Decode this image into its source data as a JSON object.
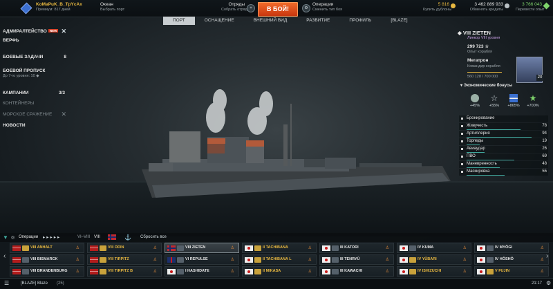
{
  "player": {
    "name": "KoMaPuK_B_TpYcAx",
    "premium": "Премиум: 817 дней"
  },
  "port": {
    "name": "Океан",
    "hint": "Выбрать порт"
  },
  "squad": {
    "title": "Отряды",
    "hint": "Собрать отряд"
  },
  "battle_button": "В БОЙ!",
  "operations": {
    "title": "Операции",
    "hint": "Сменить тип боя"
  },
  "currency": {
    "doubloons": {
      "value": "5 816",
      "hint": "Купить дублоны"
    },
    "credits": {
      "value": "3 462 889 933",
      "hint": "Обменять кредиты"
    },
    "free_xp": {
      "value": "3 766 043",
      "hint": "Перевести опыт"
    }
  },
  "tabs": [
    "ПОРТ",
    "ОСНАЩЕНИЕ",
    "ВНЕШНИЙ ВИД",
    "РАЗВИТИЕ",
    "ПРОФИЛЬ",
    "[BLAZE]"
  ],
  "left_menu": {
    "admiralty": "АДМИРАЛТЕЙСТВО",
    "admiralty_badge": "NEW",
    "shipyard": "ВЕРФЬ",
    "combat_missions": "БОЕВЫЕ ЗАДАЧИ",
    "combat_missions_count": "8",
    "battle_pass": "БОЕВОЙ ПРОПУСК",
    "battle_pass_sub": "До 7-го уровня: 10",
    "campaigns": "КАМПАНИИ",
    "campaigns_count": "3/3",
    "containers": "КОНТЕЙНЕРЫ",
    "naval_battle": "МОРСКОЕ СРАЖЕНИЕ",
    "news": "НОВОСТИ"
  },
  "ship_panel": {
    "name": "VIII ZIETEN",
    "type": "Линкор VIII уровня",
    "xp": "299 723",
    "xp_label": "Опыт корабля",
    "commander": "Мегатрон",
    "commander_role": "Командир корабля",
    "commander_xp": "560 128 / 700 000",
    "commander_level": "20",
    "economy_title": "Экономические бонусы",
    "economy": [
      "+45%",
      "+55%",
      "+865%",
      "+700%"
    ],
    "stats": [
      {
        "label": "Бронирование",
        "value": ""
      },
      {
        "label": "Живучесть",
        "value": "78"
      },
      {
        "label": "Артиллерия",
        "value": "94"
      },
      {
        "label": "Торпеды",
        "value": "19"
      },
      {
        "label": "Авиаудар",
        "value": "26"
      },
      {
        "label": "ПВО",
        "value": "69"
      },
      {
        "label": "Маневренность",
        "value": "48"
      },
      {
        "label": "Маскировка",
        "value": "55"
      }
    ]
  },
  "filter_bar": {
    "mode": "Операции",
    "tiers": "VI–VIII",
    "tier_sel": "VIII",
    "reset": "Сбросить все"
  },
  "ships": [
    {
      "name": "VIII ANHALT",
      "flag": "de",
      "tier": "gold",
      "sel": false
    },
    {
      "name": "VIII ODIN",
      "flag": "de",
      "tier": "gold",
      "sel": false
    },
    {
      "name": "VIII ZIETEN",
      "flag": "no",
      "tier": "grey",
      "sel": true
    },
    {
      "name": "II TACHIBANA",
      "flag": "jp",
      "tier": "gold",
      "sel": false
    },
    {
      "name": "III KATORI",
      "flag": "jp",
      "tier": "grey",
      "sel": false
    },
    {
      "name": "IV KUMA",
      "flag": "jp",
      "tier": "grey",
      "sel": false
    },
    {
      "name": "IV MYŌGI",
      "flag": "jp",
      "tier": "grey",
      "sel": false
    },
    {
      "name": "VIII BISMARCK",
      "flag": "de",
      "tier": "grey",
      "sel": false
    },
    {
      "name": "VIII TIRPITZ",
      "flag": "de",
      "tier": "gold",
      "sel": false
    },
    {
      "name": "VI REPULSE",
      "flag": "uk",
      "tier": "grey",
      "sel": false
    },
    {
      "name": "II TACHIBANA L",
      "flag": "jp",
      "tier": "gold",
      "sel": false
    },
    {
      "name": "III TENRYŪ",
      "flag": "jp",
      "tier": "grey",
      "sel": false
    },
    {
      "name": "IV YŪBARI",
      "flag": "jp",
      "tier": "gold",
      "sel": false
    },
    {
      "name": "IV HŌSHŌ",
      "flag": "jp",
      "tier": "grey",
      "sel": false
    },
    {
      "name": "VIII BRANDENBURG",
      "flag": "de",
      "tier": "grey",
      "sel": false
    },
    {
      "name": "VIII TIRPITZ B",
      "flag": "de",
      "tier": "gold",
      "sel": false
    },
    {
      "name": "I HASHIDATE",
      "flag": "jp",
      "tier": "grey",
      "sel": false
    },
    {
      "name": "II MIKASA",
      "flag": "jp",
      "tier": "gold",
      "sel": false
    },
    {
      "name": "III KAWACHI",
      "flag": "jp",
      "tier": "grey",
      "sel": false
    },
    {
      "name": "IV ISHIZUCHI",
      "flag": "jp",
      "tier": "gold",
      "sel": false
    },
    {
      "name": "V FUJIN",
      "flag": "jp",
      "tier": "gold",
      "sel": false
    }
  ],
  "bottom": {
    "clan": "[BLAZE] Blaze",
    "count": "(25)",
    "time": "21:17"
  },
  "colors": {
    "battle": "#e8521e",
    "gold": "#e8b840",
    "accent": "#3fa79c"
  }
}
